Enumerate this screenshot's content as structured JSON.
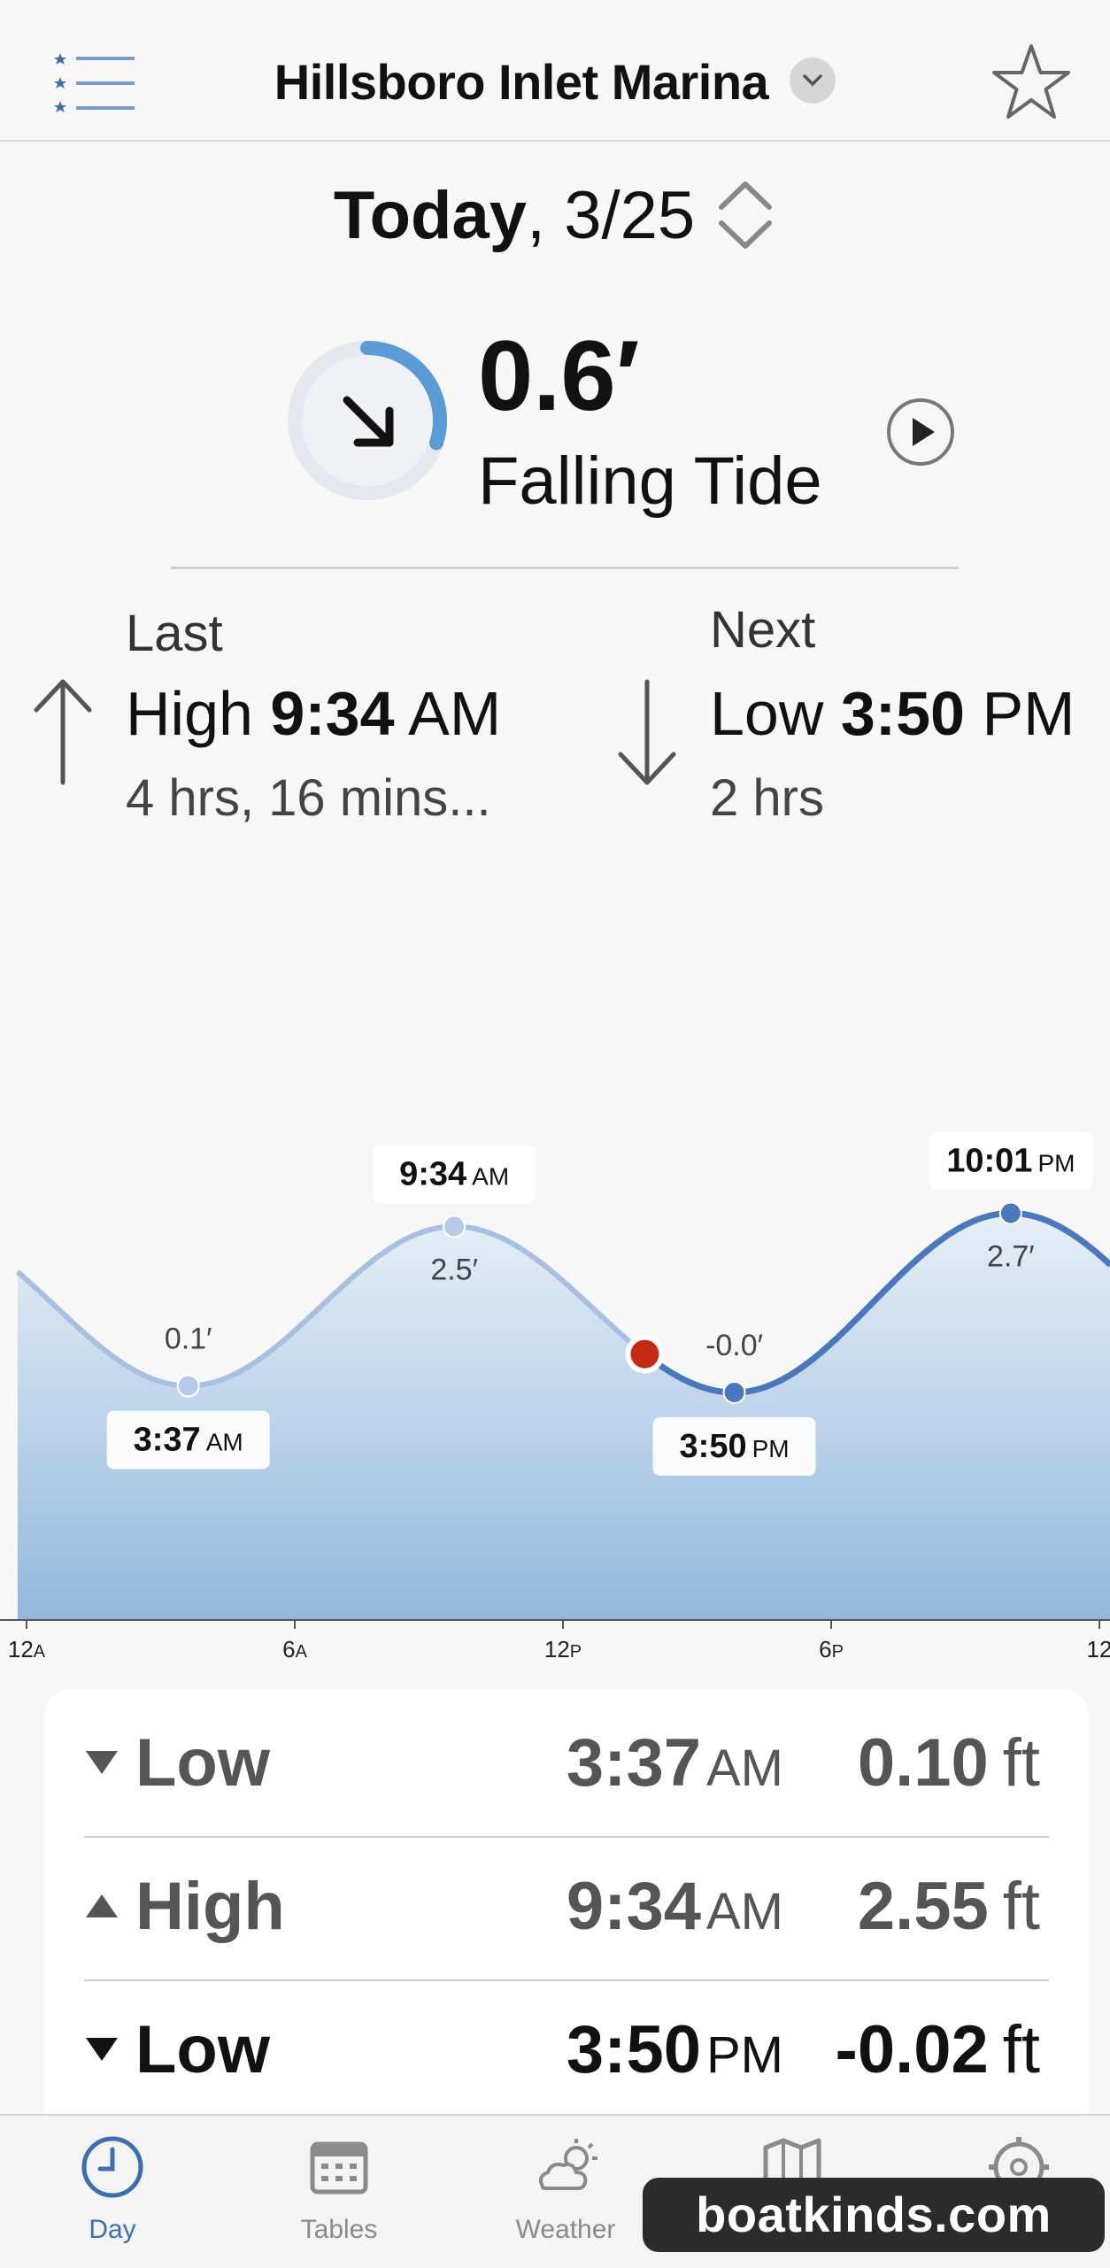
{
  "header": {
    "location": "Hillsboro Inlet Marina",
    "menu_icon": "list-icon",
    "favorite_icon": "star-icon"
  },
  "date": {
    "prefix": "Today",
    "suffix": ", 3/25"
  },
  "current": {
    "height": "0.6′",
    "state": "Falling Tide",
    "ring_progress": 0.3
  },
  "last": {
    "label": "Last",
    "type": "High",
    "time": "9:34",
    "ampm": "AM",
    "elapsed": "4 hrs, 16 mins..."
  },
  "next": {
    "label": "Next",
    "type": "Low",
    "time": "3:50",
    "ampm": "PM",
    "remaining": "2 hrs"
  },
  "chart_data": {
    "type": "area",
    "x_ticks": [
      "12A",
      "6A",
      "12P",
      "6P",
      "12"
    ],
    "xlim_hours": [
      0,
      24
    ],
    "points": [
      {
        "hour": 3.617,
        "height": 0.1,
        "height_label": "0.1′",
        "time": "3:37",
        "ampm": "AM"
      },
      {
        "hour": 9.567,
        "height": 2.5,
        "height_label": "2.5′",
        "time": "9:34",
        "ampm": "AM"
      },
      {
        "hour": 15.833,
        "height": -0.0,
        "height_label": "-0.0′",
        "time": "3:50",
        "ampm": "PM"
      },
      {
        "hour": 22.017,
        "height": 2.7,
        "height_label": "2.7′",
        "time": "10:01",
        "ampm": "PM"
      }
    ],
    "now_hour": 13.83,
    "colors": {
      "past": "#a7bfe0",
      "future": "#4a78bd",
      "now_marker": "#c62a13"
    }
  },
  "table": [
    {
      "type": "Low",
      "direction": "down",
      "time": "3:37",
      "ampm": "AM",
      "value": "0.10",
      "unit": "ft",
      "past": true
    },
    {
      "type": "High",
      "direction": "up",
      "time": "9:34",
      "ampm": "AM",
      "value": "2.55",
      "unit": "ft",
      "past": true
    },
    {
      "type": "Low",
      "direction": "down",
      "time": "3:50",
      "ampm": "PM",
      "value": "-0.02",
      "unit": "ft",
      "past": false
    }
  ],
  "tabs": [
    {
      "label": "Day",
      "icon": "clock-icon",
      "active": true
    },
    {
      "label": "Tables",
      "icon": "calendar-icon",
      "active": false
    },
    {
      "label": "Weather",
      "icon": "weather-icon",
      "active": false
    },
    {
      "label": "",
      "icon": "map-icon",
      "active": false
    },
    {
      "label": "",
      "icon": "settings-icon",
      "active": false
    }
  ],
  "watermark": "boatkinds.com",
  "colors": {
    "accent": "#3d6fb0",
    "ring": "#5b9bd5"
  }
}
